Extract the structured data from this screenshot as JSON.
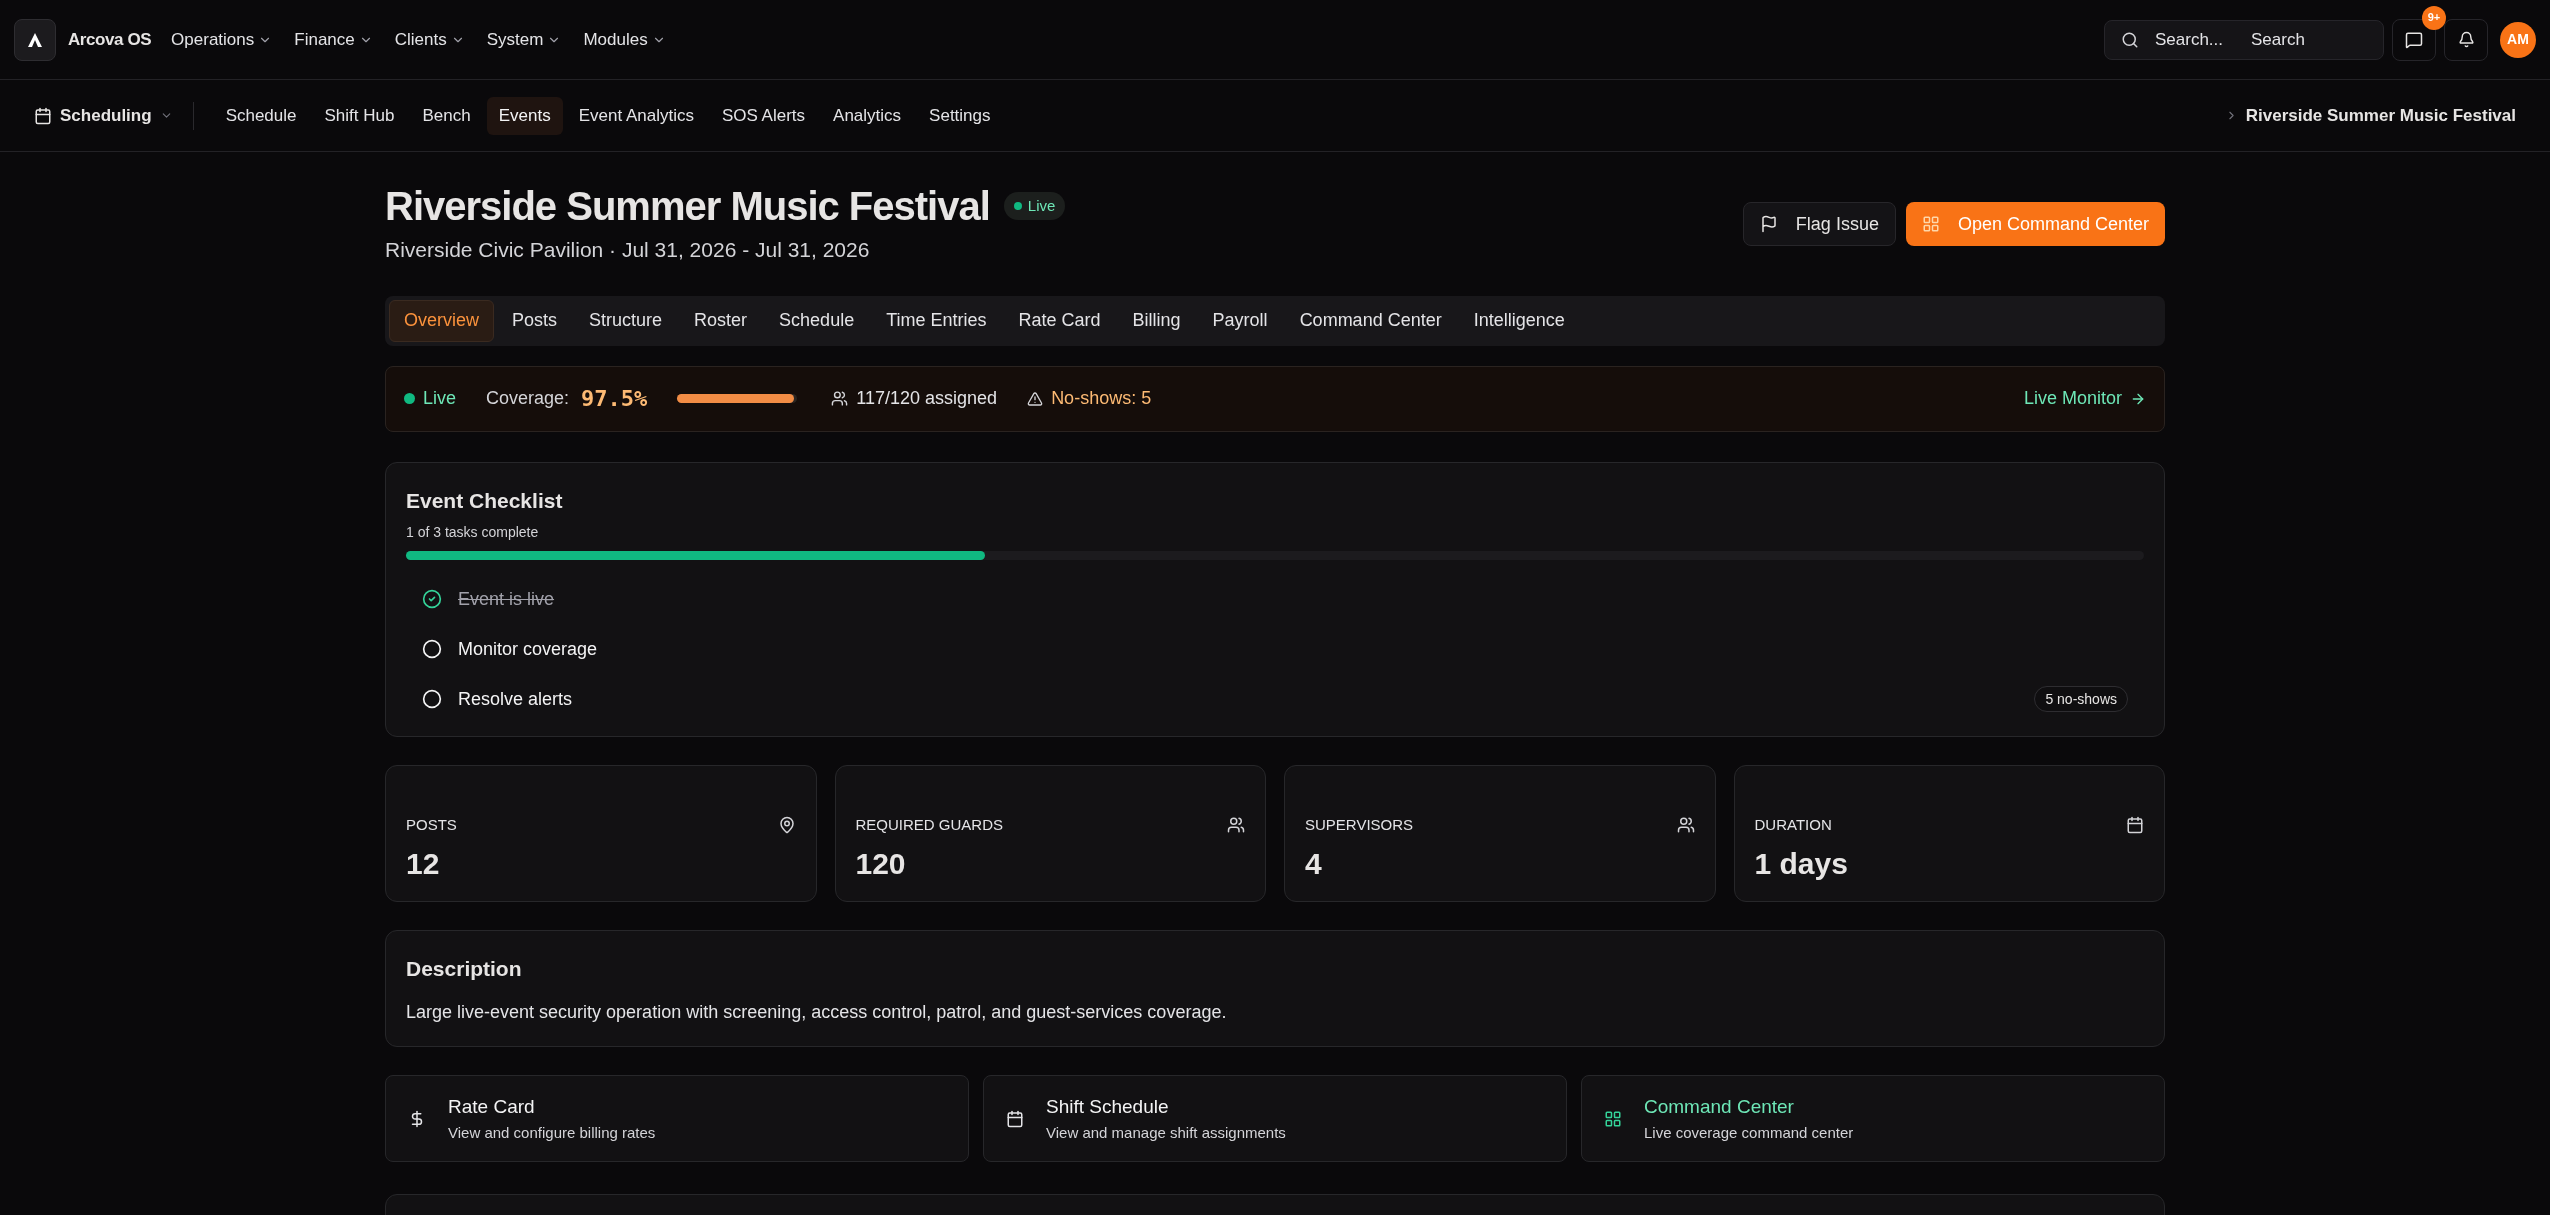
{
  "top_nav": {
    "brand": "Arcova OS",
    "menus": [
      {
        "label": "Operations"
      },
      {
        "label": "Finance"
      },
      {
        "label": "Clients"
      },
      {
        "label": "System"
      },
      {
        "label": "Modules"
      }
    ],
    "search": {
      "placeholder": "Search...",
      "hint": "Search"
    },
    "messages_badge": "9+",
    "avatar": "AM"
  },
  "sub_nav": {
    "section": "Scheduling",
    "items": [
      {
        "label": "Schedule",
        "selected": false
      },
      {
        "label": "Shift Hub",
        "selected": false
      },
      {
        "label": "Bench",
        "selected": false
      },
      {
        "label": "Events",
        "selected": true
      },
      {
        "label": "Event Analytics",
        "selected": false
      },
      {
        "label": "SOS Alerts",
        "selected": false
      },
      {
        "label": "Analytics",
        "selected": false
      },
      {
        "label": "Settings",
        "selected": false
      }
    ],
    "breadcrumb": "Riverside Summer Music Festival"
  },
  "header": {
    "title": "Riverside Summer Music Festival",
    "status": "Live",
    "subtitle": "Riverside Civic Pavilion · Jul 31, 2026 - Jul 31, 2026",
    "actions": [
      {
        "label": "Flag Issue",
        "kind": "secondary"
      },
      {
        "label": "Open Command Center",
        "kind": "primary"
      }
    ]
  },
  "tabs": [
    {
      "label": "Overview",
      "selected": true
    },
    {
      "label": "Posts",
      "selected": false
    },
    {
      "label": "Structure",
      "selected": false
    },
    {
      "label": "Roster",
      "selected": false
    },
    {
      "label": "Schedule",
      "selected": false
    },
    {
      "label": "Time Entries",
      "selected": false
    },
    {
      "label": "Rate Card",
      "selected": false
    },
    {
      "label": "Billing",
      "selected": false
    },
    {
      "label": "Payroll",
      "selected": false
    },
    {
      "label": "Command Center",
      "selected": false
    },
    {
      "label": "Intelligence",
      "selected": false
    }
  ],
  "status_bar": {
    "status": "Live",
    "coverage_label": "Coverage:",
    "coverage_value": "97.5%",
    "level": 0.975,
    "assigned": "117/120 assigned",
    "no_shows": "No-shows: 5",
    "link": "Live Monitor"
  },
  "checklist": {
    "title": "Event Checklist",
    "progress_text": "1 of 3 tasks complete",
    "level": 0.333,
    "tasks": [
      {
        "label": "Event is live",
        "checked": true
      },
      {
        "label": "Monitor coverage",
        "checked": false
      },
      {
        "label": "Resolve alerts",
        "checked": false,
        "badge": "5 no-shows"
      }
    ]
  },
  "stats": [
    {
      "label": "POSTS",
      "value": "12"
    },
    {
      "label": "REQUIRED GUARDS",
      "value": "120"
    },
    {
      "label": "SUPERVISORS",
      "value": "4"
    },
    {
      "label": "DURATION",
      "value": "1 days"
    }
  ],
  "description": {
    "title": "Description",
    "text": "Large live-event security operation with screening, access control, patrol, and guest-services coverage."
  },
  "links": [
    {
      "title": "Rate Card",
      "subtitle": "View and configure billing rates",
      "highlighted": false
    },
    {
      "title": "Shift Schedule",
      "subtitle": "View and manage shift assignments",
      "highlighted": false
    },
    {
      "title": "Command Center",
      "subtitle": "Live coverage command center",
      "highlighted": true
    }
  ]
}
